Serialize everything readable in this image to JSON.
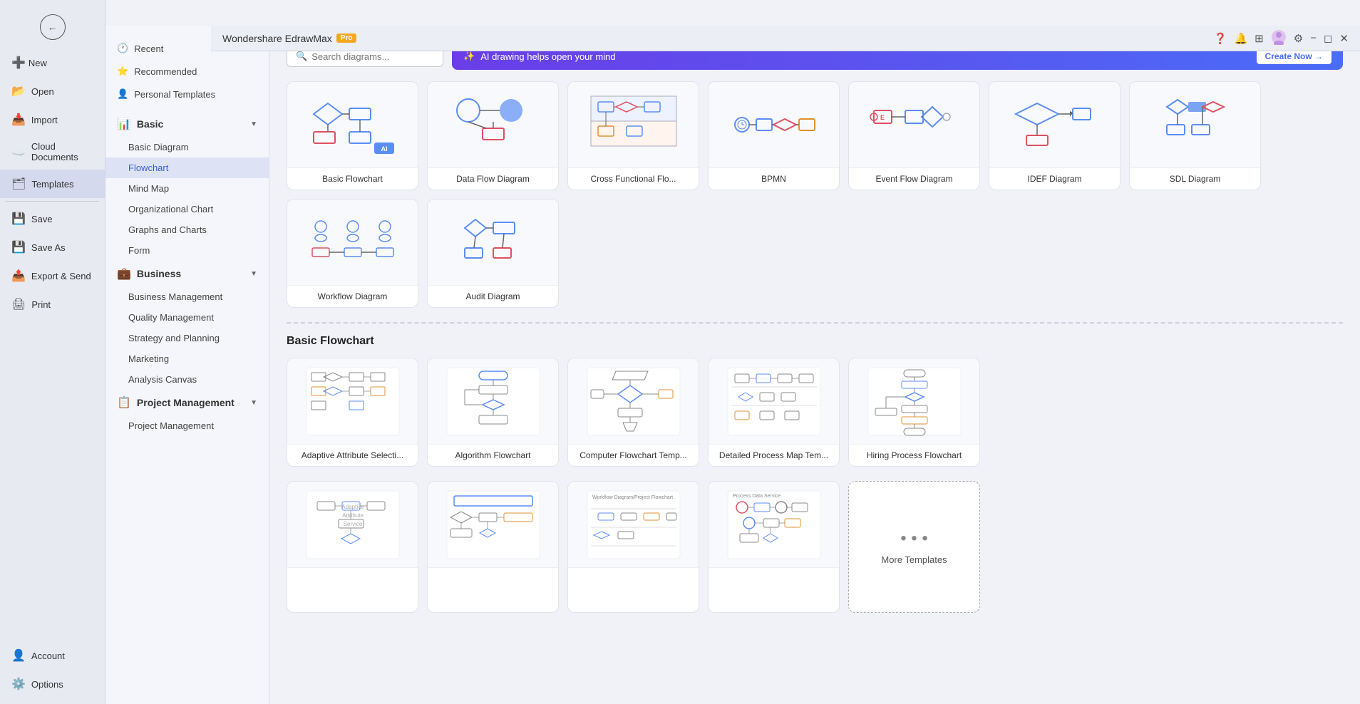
{
  "app": {
    "title": "Wondershare EdrawMax",
    "pro_badge": "Pro"
  },
  "header": {
    "title": "Wondershare EdrawMax",
    "icons": [
      "help",
      "bell",
      "grid",
      "user",
      "settings"
    ]
  },
  "sidebar": {
    "back_label": "←",
    "items": [
      {
        "id": "new",
        "label": "New",
        "icon": "➕"
      },
      {
        "id": "open",
        "label": "Open",
        "icon": "📂"
      },
      {
        "id": "import",
        "label": "Import",
        "icon": "📥"
      },
      {
        "id": "cloud",
        "label": "Cloud Documents",
        "icon": "☁️"
      },
      {
        "id": "templates",
        "label": "Templates",
        "icon": "🗂"
      },
      {
        "id": "save",
        "label": "Save",
        "icon": "💾"
      },
      {
        "id": "saveas",
        "label": "Save As",
        "icon": "💾"
      },
      {
        "id": "export",
        "label": "Export & Send",
        "icon": "📤"
      },
      {
        "id": "print",
        "label": "Print",
        "icon": "🖨"
      },
      {
        "id": "account",
        "label": "Account",
        "icon": "👤"
      },
      {
        "id": "options",
        "label": "Options",
        "icon": "⚙️"
      }
    ]
  },
  "middle_panel": {
    "top_items": [
      {
        "id": "recent",
        "label": "Recent",
        "icon": "🕐"
      },
      {
        "id": "recommended",
        "label": "Recommended",
        "icon": "⭐"
      },
      {
        "id": "personal",
        "label": "Personal Templates",
        "icon": "👤"
      }
    ],
    "sections": [
      {
        "id": "basic",
        "label": "Basic",
        "icon": "📊",
        "expanded": true,
        "items": [
          "Basic Diagram",
          "Flowchart",
          "Mind Map",
          "Organizational Chart",
          "Graphs and Charts",
          "Form"
        ]
      },
      {
        "id": "business",
        "label": "Business",
        "icon": "💼",
        "expanded": true,
        "items": [
          "Business Management",
          "Quality Management",
          "Strategy and Planning",
          "Marketing",
          "Analysis Canvas"
        ]
      },
      {
        "id": "project",
        "label": "Project Management",
        "icon": "📋",
        "expanded": true,
        "items": [
          "Project Management"
        ]
      }
    ],
    "active_item": "Flowchart"
  },
  "search": {
    "placeholder": "Search diagrams...",
    "value": ""
  },
  "ai_banner": {
    "icon": "✨",
    "text": "AI drawing helps open your mind",
    "cta": "Create Now →"
  },
  "flowchart_templates": {
    "section_label": "Basic Flowchart",
    "cards": [
      {
        "id": "basic-flowchart",
        "label": "Basic Flowchart",
        "thumb_type": "basic_flowchart"
      },
      {
        "id": "data-flow",
        "label": "Data Flow Diagram",
        "thumb_type": "data_flow"
      },
      {
        "id": "cross-functional",
        "label": "Cross Functional Flo...",
        "thumb_type": "cross_functional"
      },
      {
        "id": "bpmn",
        "label": "BPMN",
        "thumb_type": "bpmn"
      },
      {
        "id": "event-flow",
        "label": "Event Flow Diagram",
        "thumb_type": "event_flow"
      },
      {
        "id": "idef",
        "label": "IDEF Diagram",
        "thumb_type": "idef"
      },
      {
        "id": "sdl",
        "label": "SDL Diagram",
        "thumb_type": "sdl"
      },
      {
        "id": "workflow",
        "label": "Workflow Diagram",
        "thumb_type": "workflow"
      },
      {
        "id": "audit",
        "label": "Audit Diagram",
        "thumb_type": "audit"
      }
    ]
  },
  "basic_flowchart_section": {
    "section_label": "Basic Flowchart",
    "cards": [
      {
        "id": "adaptive",
        "label": "Adaptive Attribute Selecti..."
      },
      {
        "id": "algorithm",
        "label": "Algorithm Flowchart"
      },
      {
        "id": "computer",
        "label": "Computer Flowchart Temp..."
      },
      {
        "id": "detailed",
        "label": "Detailed Process Map Tem..."
      },
      {
        "id": "hiring",
        "label": "Hiring Process Flowchart"
      }
    ],
    "row2": [
      {
        "id": "r2a",
        "label": ""
      },
      {
        "id": "r2b",
        "label": ""
      },
      {
        "id": "r2c",
        "label": ""
      },
      {
        "id": "r2d",
        "label": ""
      }
    ],
    "more_label": "More Templates"
  }
}
